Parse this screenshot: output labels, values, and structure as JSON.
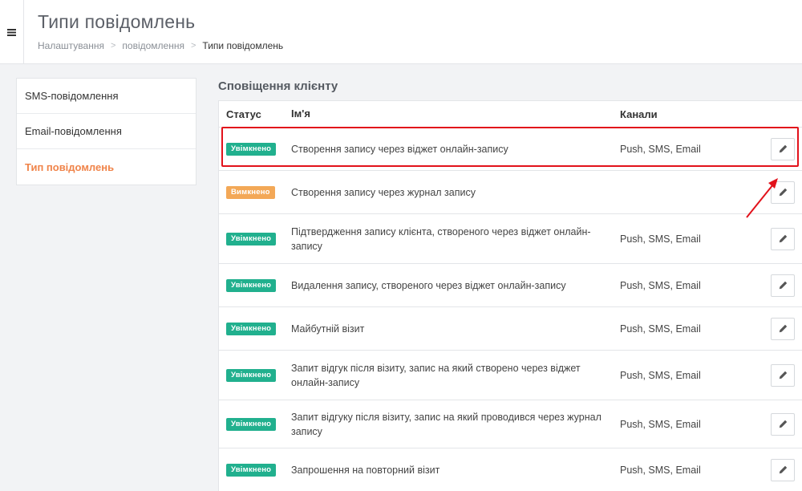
{
  "header": {
    "menu_icon": "hamburger-icon",
    "title": "Типи повідомлень",
    "breadcrumb": [
      "Налаштування",
      "повідомлення",
      "Типи повідомлень"
    ],
    "breadcrumb_separator": ">"
  },
  "sidebar": {
    "items": [
      {
        "label": "SMS-повідомлення",
        "active": false
      },
      {
        "label": "Email-повідомлення",
        "active": false
      },
      {
        "label": "Тип повідомлень",
        "active": true
      }
    ],
    "active_color": "#f0844a"
  },
  "main": {
    "section_title": "Сповіщення клієнту",
    "columns": [
      "Статус",
      "Ім'я",
      "Канали"
    ],
    "rows": [
      {
        "status": "Увімкнено",
        "state": "on",
        "name": "Створення запису через віджет онлайн-запису",
        "channels": "Push, SMS, Email"
      },
      {
        "status": "Вимкнено",
        "state": "off",
        "name": "Створення запису через журнал запису",
        "channels": ""
      },
      {
        "status": "Увімкнено",
        "state": "on",
        "name": "Підтвердження запису клієнта, створеного через віджет онлайн-запису",
        "channels": "Push, SMS, Email"
      },
      {
        "status": "Увімкнено",
        "state": "on",
        "name": "Видалення запису, створеного через віджет онлайн-запису",
        "channels": "Push, SMS, Email"
      },
      {
        "status": "Увімкнено",
        "state": "on",
        "name": "Майбутній візит",
        "channels": "Push, SMS, Email"
      },
      {
        "status": "Увімкнено",
        "state": "on",
        "name": "Запит відгук після візиту, запис на який створено через віджет онлайн-запису",
        "channels": "Push, SMS, Email"
      },
      {
        "status": "Увімкнено",
        "state": "on",
        "name": "Запит відгуку після візиту, запис на який проводився через журнал запису",
        "channels": "Push, SMS, Email"
      },
      {
        "status": "Увімкнено",
        "state": "on",
        "name": "Запрошення на повторний візит",
        "channels": "Push, SMS, Email"
      }
    ],
    "edit_icon": "pencil-icon"
  },
  "colors": {
    "status_on": "#21b08e",
    "status_off": "#f3a857",
    "annotation": "#e2121b"
  }
}
